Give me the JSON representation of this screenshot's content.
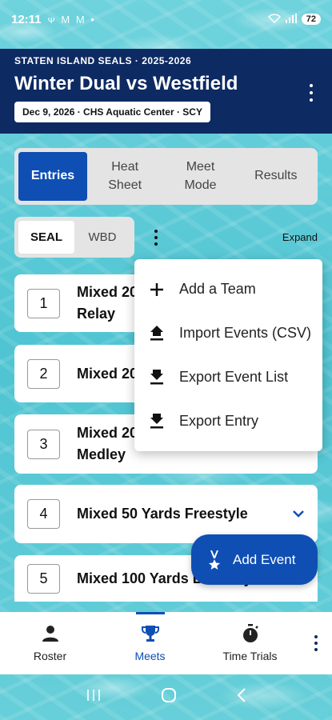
{
  "status": {
    "time": "12:11",
    "notifications": "ᴪ M M •",
    "battery": "72"
  },
  "header": {
    "subtitle": "STATEN ISLAND SEALS · 2025-2026",
    "title": "Winter Dual vs Westfield",
    "details": "Dec 9, 2026 · CHS Aquatic Center · SCY"
  },
  "tabs": [
    {
      "label": "Entries",
      "active": true
    },
    {
      "label": "Heat Sheet",
      "active": false
    },
    {
      "label": "Meet Mode",
      "active": false
    },
    {
      "label": "Results",
      "active": false
    }
  ],
  "teams": [
    {
      "label": "SEAL",
      "active": true
    },
    {
      "label": "WBD",
      "active": false
    }
  ],
  "expand_label": "Expand",
  "events": [
    {
      "number": "1",
      "name": "Mixed 20",
      "name2": "Relay"
    },
    {
      "number": "2",
      "name": "Mixed 20"
    },
    {
      "number": "3",
      "name": "Mixed 20",
      "name2": "Medley"
    },
    {
      "number": "4",
      "name": "Mixed 50 Yards Freestyle"
    },
    {
      "number": "5",
      "name": "Mixed 100 Yards Butterfly"
    }
  ],
  "menu": {
    "items": [
      {
        "label": "Add a Team",
        "icon": "plus-icon"
      },
      {
        "label": "Import Events (CSV)",
        "icon": "upload-icon"
      },
      {
        "label": "Export Event List",
        "icon": "download-icon"
      },
      {
        "label": "Export Entry",
        "icon": "download-icon"
      }
    ]
  },
  "fab": {
    "label": "Add Event",
    "icon": "medal-icon"
  },
  "nav": [
    {
      "label": "Roster",
      "icon": "person-icon",
      "active": false
    },
    {
      "label": "Meets",
      "icon": "trophy-icon",
      "active": true
    },
    {
      "label": "Time Trials",
      "icon": "stopwatch-icon",
      "active": false
    }
  ],
  "colors": {
    "header": "#0d2a63",
    "accent": "#0f4fb4",
    "water": "#5fcdd8"
  }
}
